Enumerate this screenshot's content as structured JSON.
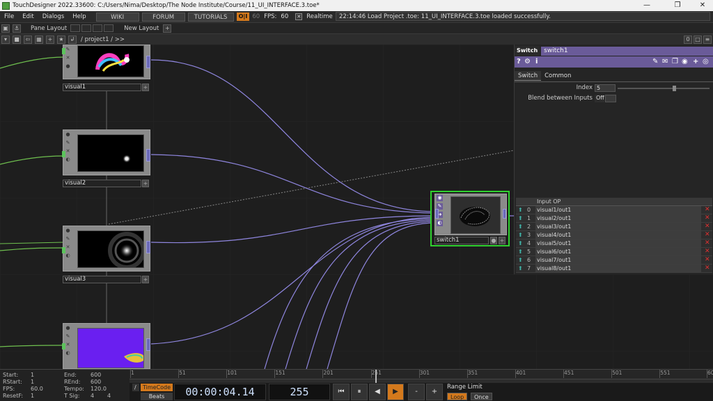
{
  "window": {
    "title": "TouchDesigner 2022.33600: C:/Users/Nima/Desktop/The Node Institute/Course/11_UI_INTERFACE.3.toe*",
    "minimize": "—",
    "maximize": "❐",
    "close": "✕"
  },
  "menubar": {
    "file": "File",
    "edit": "Edit",
    "dialogs": "Dialogs",
    "help": "Help",
    "wiki": "WIKI",
    "forum": "FORUM",
    "tutorials": "TUTORIALS",
    "oi": "O|I",
    "fps_target": "60",
    "fps_label": "FPS:",
    "fps_value": "60",
    "realtime": "Realtime",
    "status": "22:14:46 Load Project .toe: 11_UI_INTERFACE.3.toe loaded successfully."
  },
  "panebar": {
    "pane_layout": "Pane Layout",
    "new_layout": "New Layout",
    "plus": "+"
  },
  "pathbar": {
    "path": "/ project1 / >>",
    "pane_index": "0"
  },
  "operators": [
    {
      "name": "visual1"
    },
    {
      "name": "visual2"
    },
    {
      "name": "visual3"
    },
    {
      "name": "visual4"
    }
  ],
  "switch_op": {
    "name": "switch1"
  },
  "params": {
    "op_type": "Switch",
    "op_name": "switch1",
    "tabs": [
      "Switch",
      "Common"
    ],
    "index_label": "Index",
    "index_value": "5",
    "index_slider_fraction": 0.625,
    "blend_label": "Blend between Inputs",
    "blend_value": "Off",
    "table_header": "Input OP",
    "inputs": [
      {
        "idx": "0",
        "name": "visual1/out1"
      },
      {
        "idx": "1",
        "name": "visual2/out1"
      },
      {
        "idx": "2",
        "name": "visual3/out1"
      },
      {
        "idx": "3",
        "name": "visual4/out1"
      },
      {
        "idx": "4",
        "name": "visual5/out1"
      },
      {
        "idx": "5",
        "name": "visual6/out1"
      },
      {
        "idx": "6",
        "name": "visual7/out1"
      },
      {
        "idx": "7",
        "name": "visual8/out1"
      }
    ],
    "accent_color": "#6a5b99"
  },
  "timeline": {
    "start_label": "Start:",
    "start_value": "1",
    "end_label": "End:",
    "end_value": "600",
    "rstart_label": "RStart:",
    "rstart_value": "1",
    "rend_label": "REnd:",
    "rend_value": "600",
    "fps_label": "FPS:",
    "fps_value": "60.0",
    "tempo_label": "Tempo:",
    "tempo_value": "120.0",
    "resetf_label": "ResetF:",
    "resetf_value": "1",
    "tsig_label": "T Sig:",
    "tsig_num": "4",
    "tsig_den": "4",
    "ruler_ticks": [
      "1",
      "51",
      "101",
      "151",
      "201",
      "251",
      "301",
      "351",
      "401",
      "451",
      "501",
      "551",
      "600"
    ],
    "timecode_label": "TimeCode",
    "beats_label": "Beats",
    "timecode": "00:00:04.14",
    "frame": "255",
    "range_limit": "Range Limit",
    "loop": "Loop",
    "once": "Once",
    "playhead_frame": 255,
    "range_start": 1,
    "range_end": 600
  }
}
